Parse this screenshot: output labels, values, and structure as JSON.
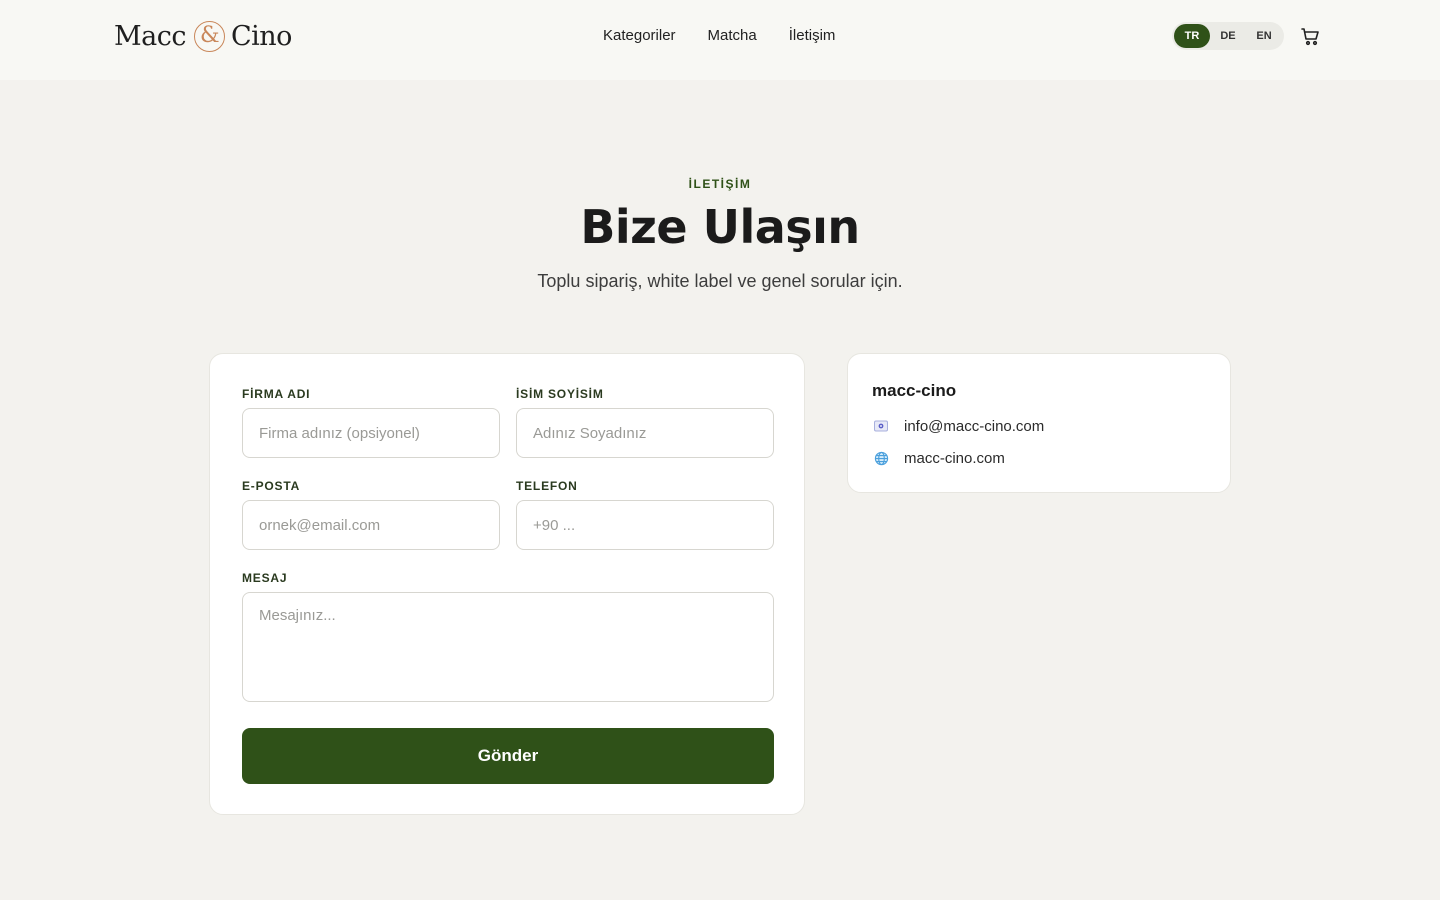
{
  "brand": {
    "left": "Macc",
    "amp": "&",
    "right": "Cino"
  },
  "nav": {
    "items": [
      "Kategoriler",
      "Matcha",
      "İletişim"
    ]
  },
  "lang": {
    "options": [
      "TR",
      "DE",
      "EN"
    ],
    "active": "TR"
  },
  "hero": {
    "kicker": "İLETİŞİM",
    "title": "Bize Ulaşın",
    "subtitle": "Toplu sipariş, white label ve genel sorular için."
  },
  "form": {
    "company_label": "FİRMA ADI",
    "company_placeholder": "Firma adınız (opsiyonel)",
    "name_label": "İSİM SOYİSİM",
    "name_placeholder": "Adınız Soyadınız",
    "email_label": "E-POSTA",
    "email_placeholder": "ornek@email.com",
    "phone_label": "TELEFON",
    "phone_placeholder": "+90 ...",
    "message_label": "MESAJ",
    "message_placeholder": "Mesajınız...",
    "submit_label": "Gönder"
  },
  "contact": {
    "title": "macc-cino",
    "email": "info@macc-cino.com",
    "website": "macc-cino.com"
  },
  "colors": {
    "accent": "#2f5118",
    "brand_copper": "#c9875a",
    "background": "#f3f2ee"
  },
  "icons": {
    "cart": "cart-icon",
    "email": "email-icon",
    "website": "globe-icon"
  }
}
